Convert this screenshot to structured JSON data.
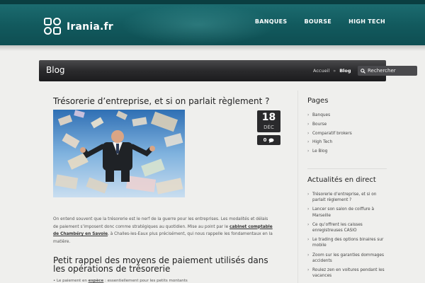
{
  "header": {
    "logo_text": "Irania.fr",
    "nav": [
      "BANQUES",
      "BOURSE",
      "HIGH TECH"
    ]
  },
  "titlebar": {
    "title": "Blog",
    "breadcrumb": {
      "home": "Accueil",
      "separator": "»",
      "current": "Blog"
    },
    "search_placeholder": "Rechercher"
  },
  "post": {
    "title": "Trésorerie d’entreprise, et si on parlait règlement ?",
    "date": {
      "day": "18",
      "month": "DÉC"
    },
    "comments": "0",
    "paragraph": {
      "part1": "On entend souvent que la trésorerie est le nerf de la guerre pour les entreprises. Les modalités et délais de paiement s’imposent donc comme stratégiques au quotidien. Mise au point par le ",
      "link": "cabinet comptable de Chambéry en Savoie",
      "part2": ", à Challes-les-Eaux plus précisément, qui nous rappelle les fondamentaux en la matière."
    },
    "subheading": "Petit rappel des moyens de paiement utilisés dans les opérations de trésorerie",
    "bullet_start": "Le paiement en ",
    "bullet_bold": "espèce",
    "bullet_end": " : essentiellement pour les petits montants"
  },
  "sidebar": {
    "pages_title": "Pages",
    "pages": [
      "Banques",
      "Bourse",
      "Comparatif brokers",
      "High Tech",
      "Le Blog"
    ],
    "news_title": "Actualités en direct",
    "news": [
      "Trésorerie d’entreprise, et si on parlait règlement ?",
      "Lancer son salon de coiffure à Marseille",
      "Ce qu’offrent les caisses enregistreuses CASIO",
      "Le trading des options binaires sur mobile",
      "Zoom sur les garanties dommages accidents",
      "Roulez zen en voitures pendant les vacances"
    ]
  },
  "colors": {
    "header": "#125a5e",
    "titlebar": "#2a2a2c",
    "background": "#efefed"
  }
}
